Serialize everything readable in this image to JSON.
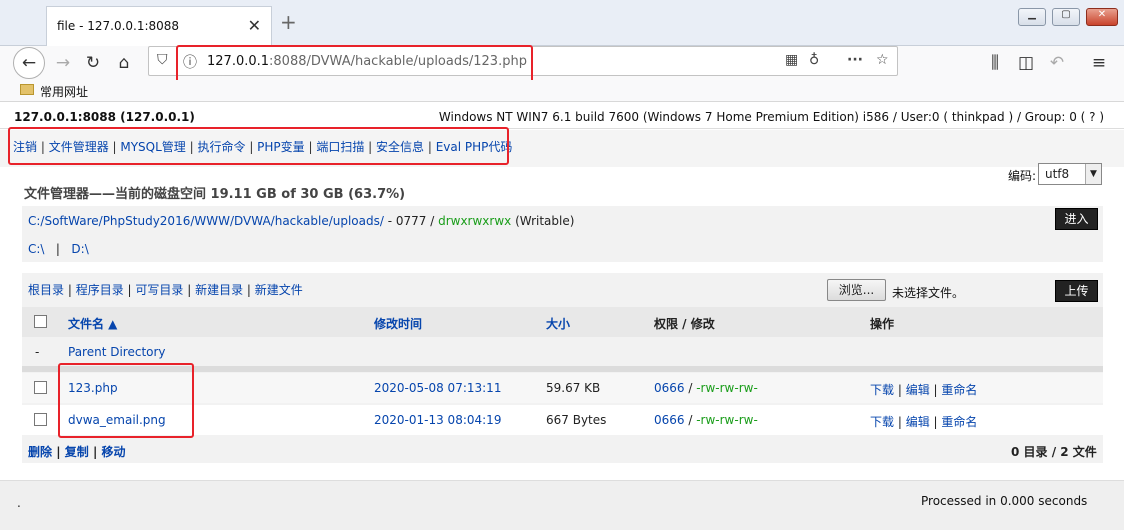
{
  "browser": {
    "tab_title": "file - 127.0.0.1:8088",
    "tab_close": "✕",
    "new_tab": "+",
    "url_host": "127.0.0.1",
    "url_rest": ":8088/DVWA/hackable/uploads/123.php",
    "bookmark_folder": "常用网址"
  },
  "page": {
    "host": "127.0.0.1:8088 (127.0.0.1)",
    "os_info": "Windows NT WIN7 6.1 build 7600 (Windows 7 Home Premium Edition) i586 / User:0 ( thinkpad ) / Group: 0 ( ? )",
    "menu": [
      "注销",
      "文件管理器",
      "MYSQL管理",
      "执行命令",
      "PHP变量",
      "端口扫描",
      "安全信息",
      "Eval PHP代码"
    ],
    "encoding_label": "编码:",
    "encoding_value": "utf8",
    "fm_title": "文件管理器——当前的磁盘空间 19.11 GB of 30 GB (63.7%)",
    "path": "C:/SoftWare/PhpStudy2016/WWW/DVWA/hackable/uploads/",
    "path_perm": " - 0777 / ",
    "path_perm_str": "drwxrwxrwx",
    "path_writable": " (Writable)",
    "go_button": "进入",
    "drive_c": "C:\\",
    "drive_d": "D:\\",
    "dir_links": [
      "根目录",
      "程序目录",
      "可写目录",
      "新建目录",
      "新建文件"
    ],
    "browse_button": "浏览...",
    "no_file": "未选择文件。",
    "upload_button": "上传",
    "headers": {
      "name": "文件名 ▲",
      "mtime": "修改时间",
      "size": "大小",
      "perm": "权限 / 修改",
      "ops": "操作"
    },
    "parent_dash": "-",
    "parent_label": "Parent Directory",
    "files": [
      {
        "name": "123.php",
        "mtime": "2020-05-08 07:13:11",
        "size": "59.67 KB",
        "perm_num": "0666",
        "perm_str": "-rw-rw-rw-",
        "ops": [
          "下载",
          "编辑",
          "重命名"
        ]
      },
      {
        "name": "dvwa_email.png",
        "mtime": "2020-01-13 08:04:19",
        "size": "667 Bytes",
        "perm_num": "0666",
        "perm_str": "-rw-rw-rw-",
        "ops": [
          "下载",
          "编辑",
          "重命名"
        ]
      }
    ],
    "bulk_ops": [
      "删除",
      "复制",
      "移动"
    ],
    "summary": "0 目录 / 2 文件",
    "status_dot": ".",
    "processed": "Processed in 0.000 seconds"
  },
  "colors": {
    "highlight_border": "#e8222a",
    "link": "#0645ad",
    "perm_green": "#1a9d1a"
  }
}
